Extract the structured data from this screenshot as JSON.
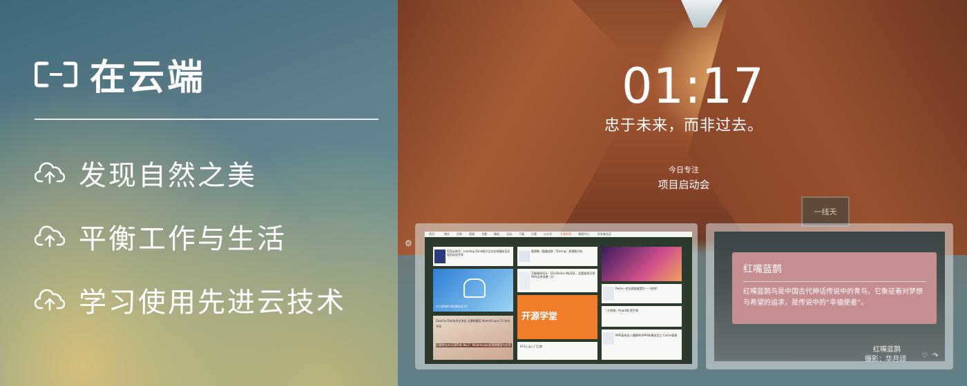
{
  "brand": {
    "logo_icon": "aliyun-bracket-icon",
    "title": "在云端"
  },
  "features": [
    {
      "icon": "cloud-upload-icon",
      "label": "发现自然之美"
    },
    {
      "icon": "cloud-upload-icon",
      "label": "平衡工作与生活"
    },
    {
      "icon": "cloud-upload-icon",
      "label": "学习使用先进云技术"
    }
  ],
  "newtab": {
    "time": "01:17",
    "motto": "忠于未来，而非过去。",
    "focus_label": "今日专注",
    "focus_value": "项目启动会",
    "sign_text": "一线天"
  },
  "screenshot": {
    "nav": [
      "首页",
      "博文",
      "问答",
      "视频",
      "专题",
      "精选",
      "活动",
      "下载",
      "大赛",
      "公众号",
      "开源学堂",
      "课程中心",
      "开发者社区"
    ],
    "tiles": [
      "阿里云账号：Landing Zone助力企业在终端安全实现自动化专享",
      "什么是物件代码事实证书?",
      "DataFunTalk技术交流会 达摩院魔搭 ModelScope CV 技术专场",
      "近摩院Open开源Talk No.2：Modelscope显视视模型与应用",
      "要想做（链路追踪（Tracing）原理和分析",
      "万能联网设计：ES+Redis+MySQL，这套架构可用99%全系场景（2）",
      "开源学堂",
      "ECS上云入门之旅",
      "Redis一步治理速度提升一一倍快?",
      "『大师课』PolarDB 黑手课",
      "MPS架构深入理解Bit/MPS和事务型之 Cache管理"
    ]
  },
  "note": {
    "title": "红嘴蓝鹊",
    "text": "红嘴蓝鹊鸟是中国古代神话传说中的青鸟，它象征着对梦想与希望的追求，是传说中的“幸福使者”。",
    "bird_name": "红嘴蓝鹊",
    "photographer": "摄影：华月颂",
    "heart_icon": "heart-icon",
    "share_icon": "share-icon"
  },
  "colors": {
    "note_bg": "#c58f92",
    "hero_rock": "#a55a34",
    "left_panel": "#5f7f8a"
  }
}
